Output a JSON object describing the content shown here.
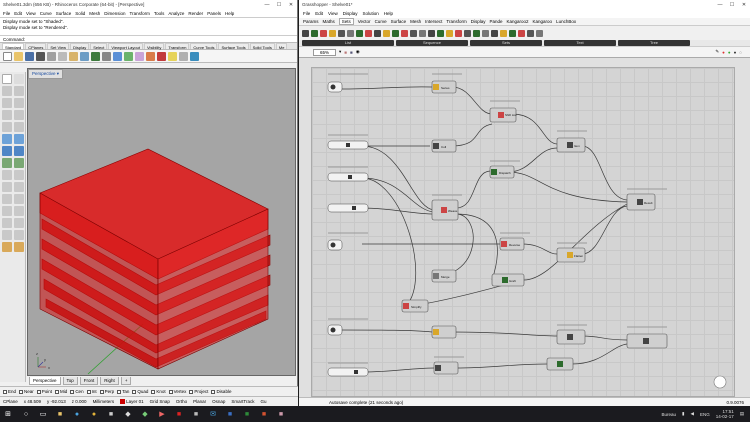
{
  "rhino": {
    "title": "Shelve01.3dm (656 KB) - Rhinoceros Corporate (64-bit) - [Perspective]",
    "menu": [
      "File",
      "Edit",
      "View",
      "Curve",
      "Surface",
      "Solid",
      "Mesh",
      "Dimension",
      "Transform",
      "Tools",
      "Analyze",
      "Render",
      "Panels",
      "Help"
    ],
    "history": [
      "Display mode set to \"Shaded\".",
      "Display mode set to \"Rendered\"."
    ],
    "command_label": "Command:",
    "tabs": [
      "Standard",
      "CPlanes",
      "Set View",
      "Display",
      "Select",
      "Viewport Layout",
      "Visibility",
      "Transform",
      "Curve Tools",
      "Surface Tools",
      "Solid Tools",
      "Me"
    ],
    "viewport_label": "Perspective",
    "view_tabs": [
      "Perspective",
      "Top",
      "Front",
      "Right"
    ],
    "osnaps": [
      "End",
      "Near",
      "Point",
      "Mid",
      "Cen",
      "Int",
      "Perp",
      "Tan",
      "Quad",
      "Knot",
      "Vertex",
      "Project",
      "Disable"
    ],
    "status": {
      "cplane": "CPlane",
      "x": "x 48.509",
      "y": "y -92.013",
      "z": "z 0.000",
      "units": "Millimeters",
      "layer": "Layer 01",
      "toggles": [
        "Grid Snap",
        "Ortho",
        "Planar",
        "Osnap",
        "SmartTrack",
        "Gu"
      ]
    },
    "axis_labels": {
      "z": "z",
      "y": "y",
      "x": "x"
    }
  },
  "gh": {
    "title": "Grasshopper - Shelve01*",
    "menu": [
      "File",
      "Edit",
      "View",
      "Display",
      "Solution",
      "Help"
    ],
    "tabs": [
      "Params",
      "Maths",
      "Sets",
      "Vector",
      "Curve",
      "Surface",
      "Mesh",
      "Intersect",
      "Transform",
      "Display",
      "Pande",
      "Kangaroo2",
      "Kangaroo",
      "LunchBox"
    ],
    "active_tab": "Sets",
    "groups": [
      "List",
      "Sequence",
      "Sets",
      "Text",
      "Tree"
    ],
    "zoom": "65%",
    "status_message": "Autosave complete (21 seconds ago)",
    "version": "0.9.0076",
    "nodes": [
      {
        "name": "Series",
        "label": "Series"
      },
      {
        "name": "Shift List",
        "label": "Shift List"
      },
      {
        "name": "Item",
        "label": "Item"
      },
      {
        "name": "Cull",
        "label": "Cull"
      },
      {
        "name": "Dispatch",
        "label": "Dispatch"
      },
      {
        "name": "Weave",
        "label": "Weave"
      },
      {
        "name": "Result",
        "label": "Result"
      },
      {
        "name": "Reverse",
        "label": "Reverse"
      },
      {
        "name": "Flatten",
        "label": "Flatten"
      },
      {
        "name": "Merge",
        "label": "Merge"
      },
      {
        "name": "Graft",
        "label": "Graft"
      },
      {
        "name": "Simplify",
        "label": "Simplify"
      }
    ]
  },
  "taskbar": {
    "lang": "ENG",
    "time": "17:51",
    "date": "14-02-17",
    "tray_text": "Bureau"
  }
}
